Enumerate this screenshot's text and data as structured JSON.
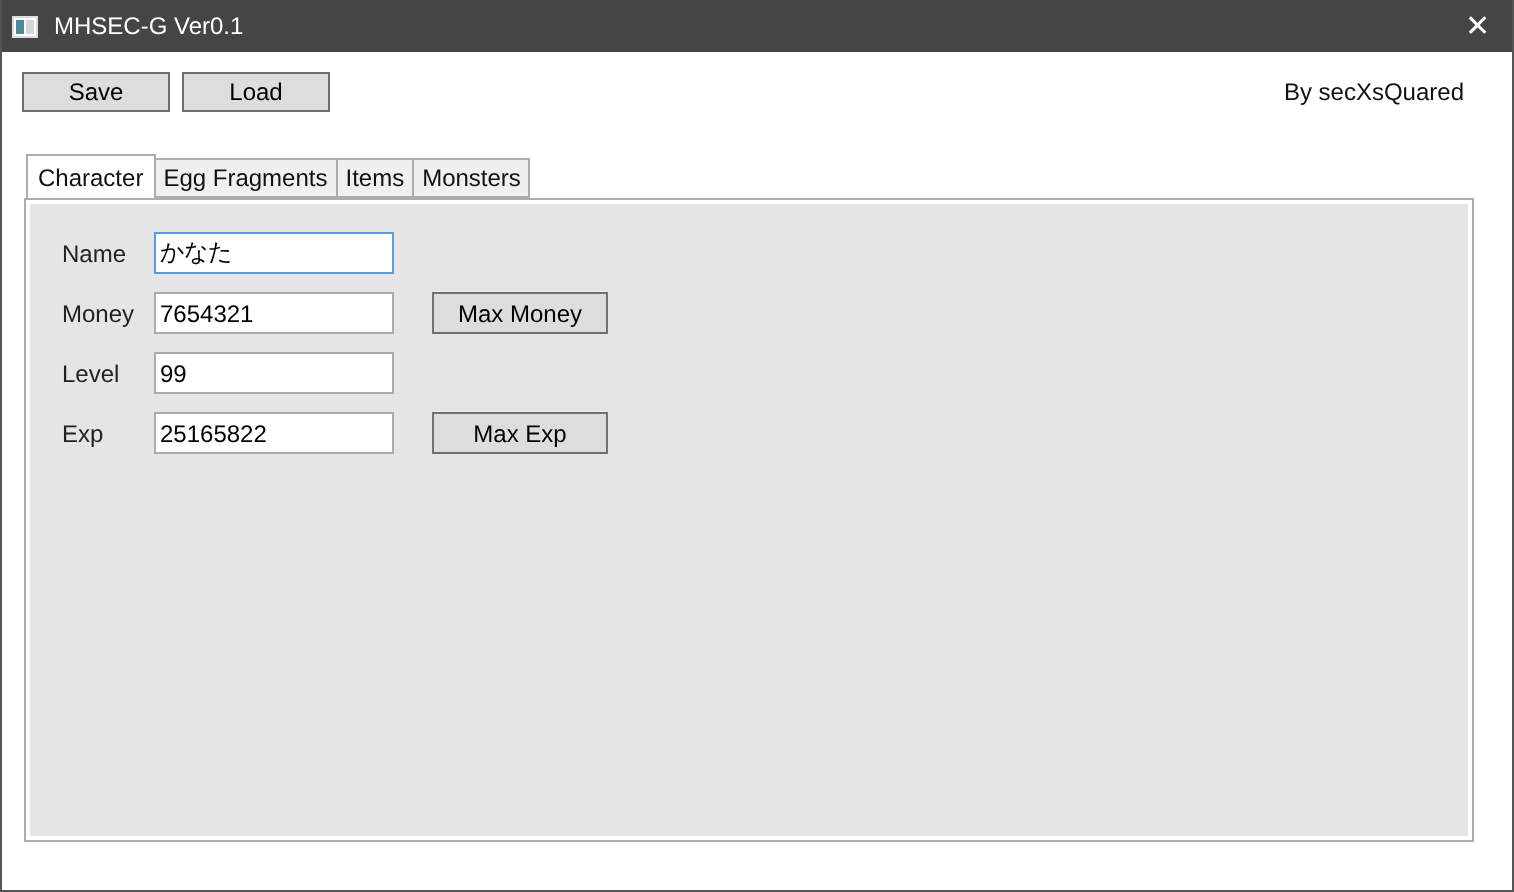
{
  "window": {
    "title": "MHSEC-G Ver0.1",
    "close": "✕"
  },
  "toolbar": {
    "buttons": [
      "Save",
      "Load"
    ],
    "credit": "By secXsQuared"
  },
  "tabs": [
    {
      "label": "Character",
      "selected": true
    },
    {
      "label": "Egg Fragments",
      "selected": false
    },
    {
      "label": "Items",
      "selected": false
    },
    {
      "label": "Monsters",
      "selected": false
    }
  ],
  "fields": [
    {
      "label": "Name",
      "value": "かなた",
      "focused": true
    },
    {
      "label": "Money",
      "value": "7654321",
      "focused": false,
      "action": "Max Money"
    },
    {
      "label": "Level",
      "value": "99",
      "focused": false
    },
    {
      "label": "Exp",
      "value": "25165822",
      "focused": false,
      "action": "Max Exp"
    }
  ]
}
